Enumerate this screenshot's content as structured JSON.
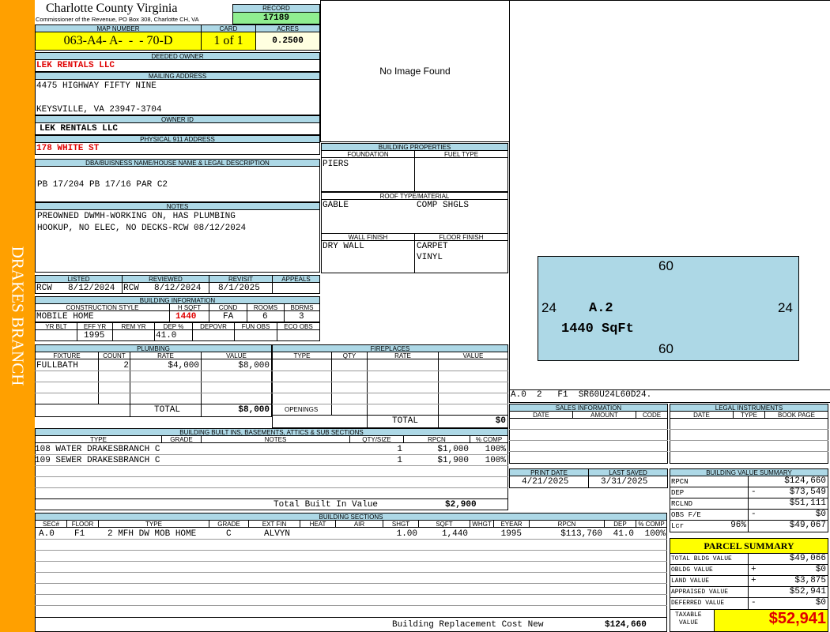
{
  "sidebar_label": "DRAKES BRANCH",
  "header": {
    "county": "Charlotte County Virginia",
    "office": "Commissioner of the Revenue, PO Box 308, Charlotte CH, VA",
    "record_label": "RECORD",
    "record": "17189",
    "map_number_label": "MAP NUMBER",
    "map_number": "063-A4- A-  -  - 70-D",
    "card_label": "CARD",
    "card": "1 of 1",
    "acres_label": "ACRES",
    "acres": "0.2500"
  },
  "owner": {
    "deeded_owner_label": "DEEDED OWNER",
    "deeded_owner": "LEK RENTALS LLC",
    "mailing_address_label": "MAILING ADDRESS",
    "mailing_line1": "4475 HIGHWAY FIFTY NINE",
    "mailing_line2": "KEYSVILLE, VA 23947-3704",
    "owner_id_label": "OWNER ID",
    "owner_id": "LEK RENTALS LLC",
    "physical_address_label": "PHYSICAL 911 ADDRESS",
    "physical_address": "178 WHITE ST",
    "legal_label": "DBA/BUISNESS NAME/HOUSE NAME & LEGAL DESCRIPTION",
    "legal": "PB 17/204 PB 17/16 PAR C2",
    "notes_label": "NOTES",
    "notes_line1": "PREOWNED DWMH-WORKING ON, HAS PLUMBING",
    "notes_line2": "HOOKUP, NO ELEC, NO DECKS-RCW 08/12/2024"
  },
  "photo": {
    "placeholder": "No Image Found"
  },
  "review": {
    "listed_label": "LISTED",
    "listed_by": "RCW",
    "listed_date": "8/12/2024",
    "reviewed_label": "REVIEWED",
    "reviewed_by": "RCW",
    "reviewed_date": "8/12/2024",
    "revisit_label": "REVISIT",
    "revisit_date": "8/1/2025",
    "appeals_label": "APPEALS"
  },
  "building_info": {
    "title": "BUILDING INFORMATION",
    "construction_style_label": "CONSTRUCTION STYLE",
    "construction_style": "MOBILE HOME",
    "hsqft_label": "H SQFT",
    "hsqft": "1440",
    "cond_label": "COND",
    "cond": "FA",
    "rooms_label": "ROOMS",
    "rooms": "6",
    "bdrms_label": "BDRMS",
    "bdrms": "3",
    "yr_blt_label": "YR BLT",
    "yr_blt": "",
    "eff_yr_label": "EFF YR",
    "eff_yr": "1995",
    "rem_yr_label": "REM YR",
    "rem_yr": "",
    "dep_label": "DEP %",
    "dep": "41.0",
    "depovr_label": "DEPOVR",
    "depovr": "",
    "fun_obs_label": "FUN OBS",
    "fun_obs": "",
    "eco_obs_label": "ECO OBS",
    "eco_obs": ""
  },
  "building_properties": {
    "title": "BUILDING PROPERTIES",
    "foundation_label": "FOUNDATION",
    "foundation": "PIERS",
    "fuel_label": "FUEL TYPE",
    "fuel": "",
    "roof_label": "ROOF TYPE/MATERIAL",
    "roof_type": "GABLE",
    "roof_material": "COMP SHGLS",
    "wall_label": "WALL FINISH",
    "wall": "DRY WALL",
    "floor_label": "FLOOR FINISH",
    "floor1": "CARPET",
    "floor2": "VINYL"
  },
  "plumbing": {
    "title": "PLUMBING",
    "cols": [
      "FIXTURE",
      "COUNT",
      "RATE",
      "VALUE"
    ],
    "rows": [
      {
        "fixture": "FULLBATH",
        "count": "2",
        "rate": "$4,000",
        "value": "$8,000"
      }
    ],
    "total_label": "TOTAL",
    "total": "$8,000"
  },
  "fireplaces": {
    "title": "FIREPLACES",
    "cols": [
      "TYPE",
      "QTY",
      "RATE",
      "VALUE"
    ],
    "openings_label": "OPENINGS",
    "total_label": "TOTAL",
    "total": "$0"
  },
  "built_ins": {
    "title": "BUILDING BUILT INS, BASEMENTS, ATTICS & SUB SECTIONS",
    "cols": [
      "TYPE",
      "GRADE",
      "NOTES",
      "QTY/SIZE",
      "RPCN",
      "% COMP"
    ],
    "rows": [
      {
        "type": "108 WATER DRAKESBRANCH C",
        "qty": "1",
        "rpcn": "$1,000",
        "comp": "100%"
      },
      {
        "type": "109 SEWER DRAKESBRANCH C",
        "qty": "1",
        "rpcn": "$1,900",
        "comp": "100%"
      }
    ],
    "total_label": "Total Built In Value",
    "total": "$2,900"
  },
  "sketch": {
    "top": "60",
    "bottom": "60",
    "left": "24",
    "right": "24",
    "section": "A.2",
    "area": "1440 SqFt",
    "code": "A.0  2   F1  SR60U24L60D24."
  },
  "sales": {
    "title": "SALES INFORMATION",
    "cols": [
      "DATE",
      "AMOUNT",
      "CODE"
    ]
  },
  "legal_instruments": {
    "title": "LEGAL INSTRUMENTS",
    "cols": [
      "DATE",
      "TYPE",
      "BOOK PAGE"
    ]
  },
  "dates": {
    "print_label": "PRINT DATE",
    "print": "4/21/2025",
    "saved_label": "LAST SAVED",
    "saved": "3/31/2025"
  },
  "value_summary": {
    "title": "BUILDING VALUE SUMMARY",
    "rows": [
      {
        "label": "RPCN",
        "sign": "",
        "value": "$124,660"
      },
      {
        "label": "DEP",
        "sign": "-",
        "value": "$73,549"
      },
      {
        "label": "RCLND",
        "sign": "",
        "value": "$51,111"
      },
      {
        "label": "OBS F/E",
        "sign": "-",
        "value": "$0"
      },
      {
        "label": "Lcr",
        "sign": "96%",
        "value": "$49,067"
      }
    ]
  },
  "parcel_summary": {
    "title": "PARCEL SUMMARY",
    "rows": [
      {
        "label": "TOTAL BLDG VALUE",
        "sign": "",
        "value": "$49,066"
      },
      {
        "label": "OBLDG VALUE",
        "sign": "+",
        "value": "$0"
      },
      {
        "label": "LAND VALUE",
        "sign": "+",
        "value": "$3,875"
      },
      {
        "label": "APPRAISED VALUE",
        "sign": "",
        "value": "$52,941"
      },
      {
        "label": "DEFERRED VALUE",
        "sign": "-",
        "value": "$0"
      }
    ],
    "taxable_label_1": "TAXABLE",
    "taxable_label_2": "VALUE",
    "taxable": "$52,941"
  },
  "sections": {
    "title": "BUILDING SECTIONS",
    "cols": [
      "SEC#",
      "FLOOR",
      "TYPE",
      "GRADE",
      "EXT FIN",
      "HEAT",
      "AIR",
      "SHGT",
      "SQFT",
      "WHGT",
      "EYEAR",
      "RPCN",
      "DEP",
      "% COMP"
    ],
    "rows": [
      {
        "sec": "A.0",
        "floor": "F1",
        "type": "2 MFH DW MOB HOME",
        "grade": "C",
        "ext": "ALVYN",
        "heat": "",
        "air": "",
        "shgt": "1.00",
        "sqft": "1,440",
        "whgt": "",
        "eyear": "1995",
        "rpcn": "$113,760",
        "dep": "41.0",
        "comp": "100%"
      }
    ],
    "total_label": "Building Replacement Cost New",
    "total": "$124,660"
  }
}
